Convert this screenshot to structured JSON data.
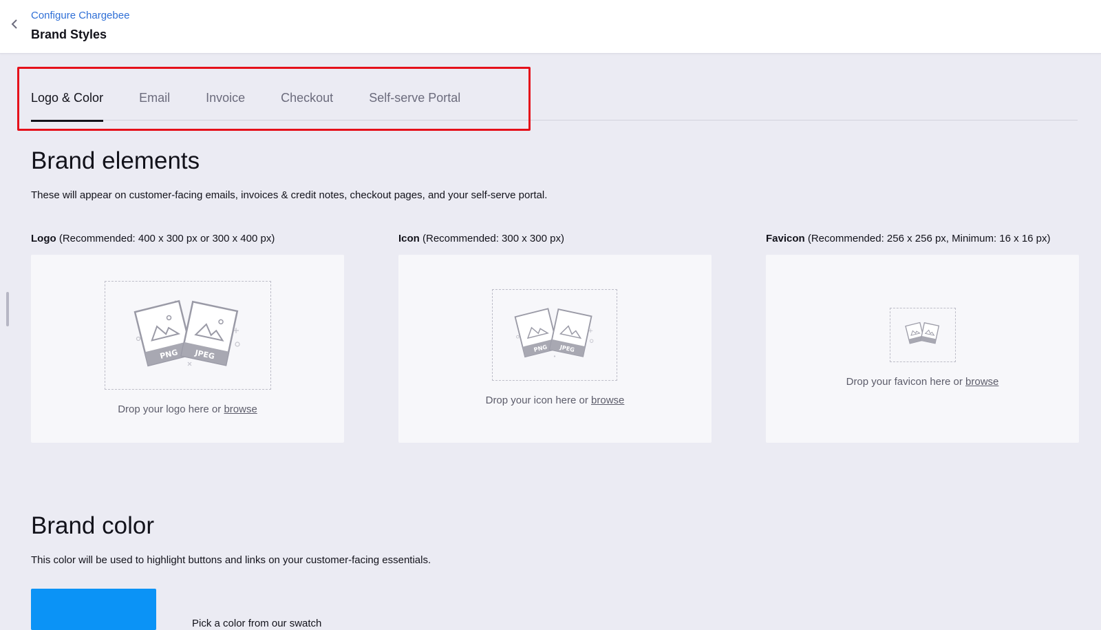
{
  "header": {
    "breadcrumb": "Configure Chargebee",
    "title": "Brand Styles"
  },
  "tabs": [
    {
      "label": "Logo & Color",
      "active": true
    },
    {
      "label": "Email",
      "active": false
    },
    {
      "label": "Invoice",
      "active": false
    },
    {
      "label": "Checkout",
      "active": false
    },
    {
      "label": "Self-serve Portal",
      "active": false
    }
  ],
  "brand_elements": {
    "title": "Brand elements",
    "description": "These will appear on customer-facing emails, invoices & credit notes, checkout pages, and your self-serve portal.",
    "logo": {
      "name": "Logo",
      "hint": " (Recommended: 400 x 300 px or 300 x 400 px)",
      "drop_text": "Drop your logo here or ",
      "browse": "browse"
    },
    "icon": {
      "name": "Icon",
      "hint": " (Recommended: 300 x 300 px)",
      "drop_text": "Drop your icon here or ",
      "browse": "browse"
    },
    "favicon": {
      "name": "Favicon",
      "hint": " (Recommended: 256 x 256 px, Minimum: 16 x 16 px)",
      "drop_text": "Drop your favicon here or ",
      "browse": "browse"
    },
    "illustration_labels": [
      "PNG",
      "JPEG"
    ]
  },
  "brand_color": {
    "title": "Brand color",
    "description": "This color will be used to highlight buttons and links on your customer-facing essentials.",
    "swatch_color": "#0b93f6",
    "swatch_caption": "Pick a color from our swatch"
  },
  "colors": {
    "link": "#2f6fd6",
    "highlight_border": "#e5101a",
    "background": "#ebebf3"
  }
}
